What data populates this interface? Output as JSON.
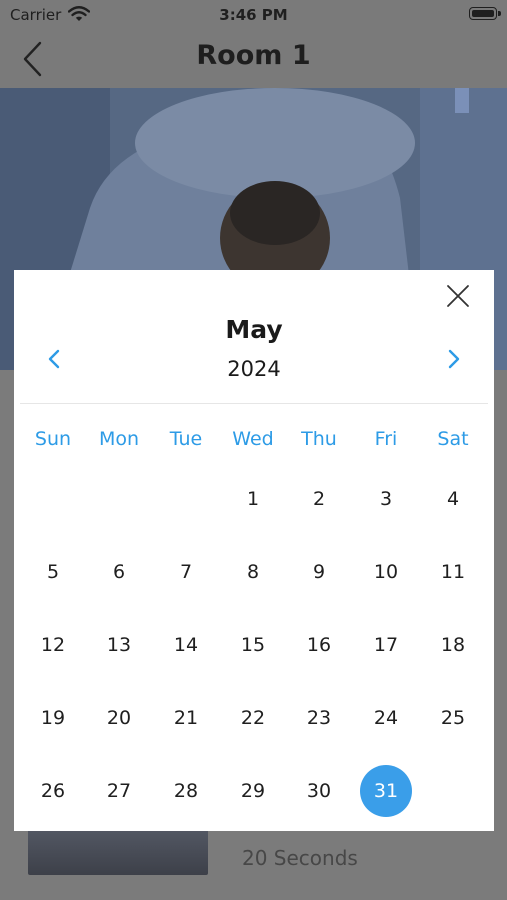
{
  "status": {
    "carrier": "Carrier",
    "time": "3:46 PM"
  },
  "nav": {
    "title": "Room 1"
  },
  "background": {
    "duration": "20 Seconds"
  },
  "calendar": {
    "month": "May",
    "year": "2024",
    "weekdays": [
      "Sun",
      "Mon",
      "Tue",
      "Wed",
      "Thu",
      "Fri",
      "Sat"
    ],
    "weeks": [
      [
        "",
        "",
        "",
        "1",
        "2",
        "3",
        "4"
      ],
      [
        "5",
        "6",
        "7",
        "8",
        "9",
        "10",
        "11"
      ],
      [
        "12",
        "13",
        "14",
        "15",
        "16",
        "17",
        "18"
      ],
      [
        "19",
        "20",
        "21",
        "22",
        "23",
        "24",
        "25"
      ],
      [
        "26",
        "27",
        "28",
        "29",
        "30",
        "31",
        ""
      ]
    ],
    "selected_day": "31",
    "accent_color": "#2d9be6",
    "selected_color": "#3a9ee9"
  }
}
